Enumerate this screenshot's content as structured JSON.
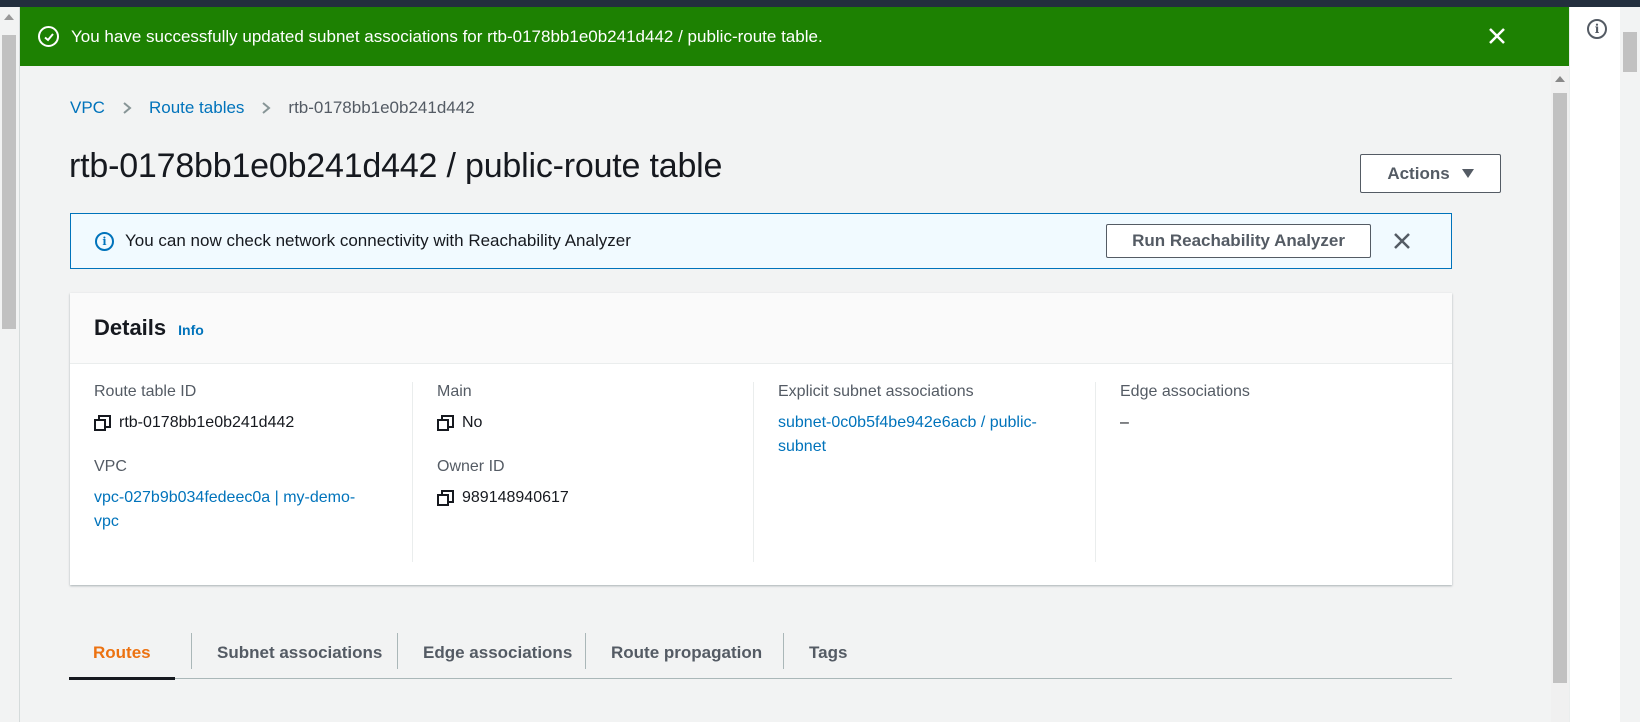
{
  "flash": {
    "message": "You have successfully updated subnet associations for rtb-0178bb1e0b241d442 / public-route table."
  },
  "breadcrumb": {
    "items": [
      "VPC",
      "Route tables"
    ],
    "current": "rtb-0178bb1e0b241d442"
  },
  "page": {
    "title": "rtb-0178bb1e0b241d442 / public-route table",
    "actions_label": "Actions"
  },
  "alert": {
    "message": "You can now check network connectivity with Reachability Analyzer",
    "button_label": "Run Reachability Analyzer"
  },
  "details": {
    "title": "Details",
    "info_label": "Info",
    "route_table_id_label": "Route table ID",
    "route_table_id": "rtb-0178bb1e0b241d442",
    "vpc_label": "VPC",
    "vpc_line1": "vpc-027b9b034fedeec0a | my-demo-",
    "vpc_line2": "vpc",
    "main_label": "Main",
    "main_value": "No",
    "owner_label": "Owner ID",
    "owner_value": "989148940617",
    "explicit_label": "Explicit subnet associations",
    "explicit_line1": "subnet-0c0b5f4be942e6acb / public-",
    "explicit_line2": "subnet",
    "edge_label": "Edge associations",
    "edge_value": "–"
  },
  "tabs": [
    "Routes",
    "Subnet associations",
    "Edge associations",
    "Route propagation",
    "Tags"
  ],
  "colors": {
    "success": "#1d8102",
    "link": "#0073bb",
    "active_tab": "#ec7211",
    "info_bg": "#f1faff"
  },
  "icons": {
    "flash": "check-circle-icon",
    "close": "close-icon",
    "info": "info-circle-icon",
    "copy": "copy-icon",
    "help": "help-info-icon"
  }
}
